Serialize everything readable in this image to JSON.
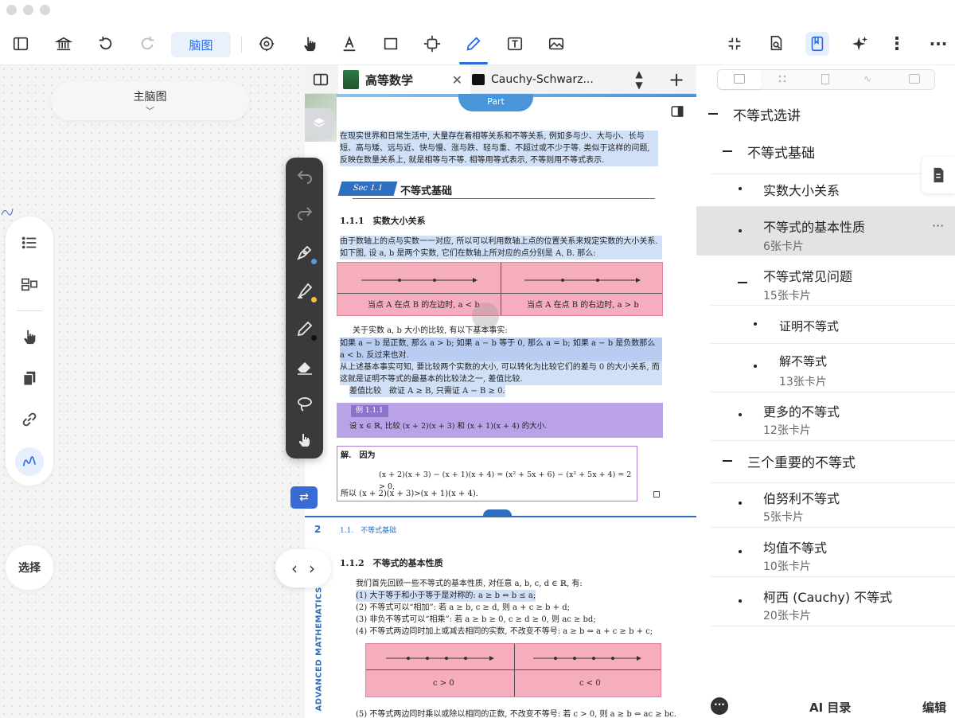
{
  "toolbar": {
    "mindmap_label": "脑图"
  },
  "canvas": {
    "main_node": "主脑图",
    "select_label": "选择"
  },
  "tabs": {
    "active": "高等数学",
    "second": "Cauchy-Schwarz..."
  },
  "doc": {
    "part_label": "Part",
    "intro": "在现实世界和日常生活中, 大量存在着相等关系和不等关系, 例如多与少、大与小、长与短、高与矮、远与近、快与慢、涨与跌、轻与重、不超过或不少于等. 类似于这样的问题, 反映在数量关系上, 就是相等与不等. 相等用等式表示, 不等则用不等式表示.",
    "sec_tag": "Sec 1.1",
    "sec_title": "不等式基础",
    "sub1": "1.1.1　实数大小关系",
    "p1": "由于数轴上的点与实数一一对应, 所以可以利用数轴上点的位置关系来规定实数的大小关系. 如下图, 设 a, b 是两个实数, 它们在数轴上所对应的点分别是 A, B. 那么:",
    "table1_left": "当点 A 在点 B 的左边时, a < b",
    "table1_right": "当点 A 在点 B 的右边时, a > b",
    "p2": "关于实数 a, b 大小的比较, 有以下基本事实:",
    "p3": "如果 a − b 是正数, 那么 a > b; 如果 a − b 等于 0, 那么 a = b; 如果 a − b 是负数那么 a < b. 反过来也对.",
    "p4": "从上述基本事实可知, 要比较两个实数的大小, 可以转化为比较它们的差与 0 的大小关系, 而这就是证明不等式的最基本的比较法之一, 差值比较.",
    "p5": "差值比较　欲证 A ≥ B, 只需证 A − B ≥ 0.",
    "example_tag": "例 1.1.1",
    "example": "设 x ∈ ℝ, 比较 (x + 2)(x + 3) 和 (x + 1)(x + 4) 的大小.",
    "solution_label": "解.　因为",
    "solution_eq": "(x + 2)(x + 3) − (x + 1)(x + 4) = (x² + 5x + 6) − (x² + 5x + 4) = 2 > 0,",
    "solution_end": "所以 (x + 2)(x + 3)>(x + 1)(x + 4).",
    "page_num": "2",
    "running_head": "1.1.　不等式基础",
    "sub2": "1.1.2　不等式的基本性质",
    "p6": "我们首先回顾一些不等式的基本性质, 对任意 a, b, c, d ∈ ℝ, 有:",
    "props": [
      "(1) 大于等于和小于等于是对称的: a ≥ b ⇔ b ≤ a;",
      "(2) 不等式可以“相加”: 若 a ≥ b, c ≥ d, 则 a + c ≥ b + d;",
      "(3) 非负不等式可以“相乘”: 若 a ≥ b ≥ 0, c ≥ d ≥ 0, 则 ac ≥ bd;",
      "(4) 不等式两边同时加上或减去相同的实数, 不改变不等号: a ≥ b ⇔ a + c ≥ b + c;"
    ],
    "table2_left": "c > 0",
    "table2_right": "c < 0",
    "prop5": "(5) 不等式两边同时乘以或除以相同的正数, 不改变不等号: 若 c > 0, 则 a ≥ b ⇔ ac ≥ bc.",
    "side_text": "ADVANCED MATHEMATICS"
  },
  "outline": {
    "items": [
      {
        "label": "不等式选讲",
        "sub": ""
      },
      {
        "label": "不等式基础",
        "sub": ""
      },
      {
        "label": "实数大小关系",
        "sub": ""
      },
      {
        "label": "不等式的基本性质",
        "sub": "6张卡片"
      },
      {
        "label": "不等式常见问题",
        "sub": "15张卡片"
      },
      {
        "label": "证明不等式",
        "sub": ""
      },
      {
        "label": "解不等式",
        "sub": "13张卡片"
      },
      {
        "label": "更多的不等式",
        "sub": "12张卡片"
      },
      {
        "label": "三个重要的不等式",
        "sub": ""
      },
      {
        "label": "伯努利不等式",
        "sub": "5张卡片"
      },
      {
        "label": "均值不等式",
        "sub": "10张卡片"
      },
      {
        "label": "柯西 (Cauchy) 不等式",
        "sub": "20张卡片"
      }
    ],
    "more": "···",
    "footer": {
      "ai_label": "AI 目录",
      "edit_label": "编辑"
    }
  }
}
